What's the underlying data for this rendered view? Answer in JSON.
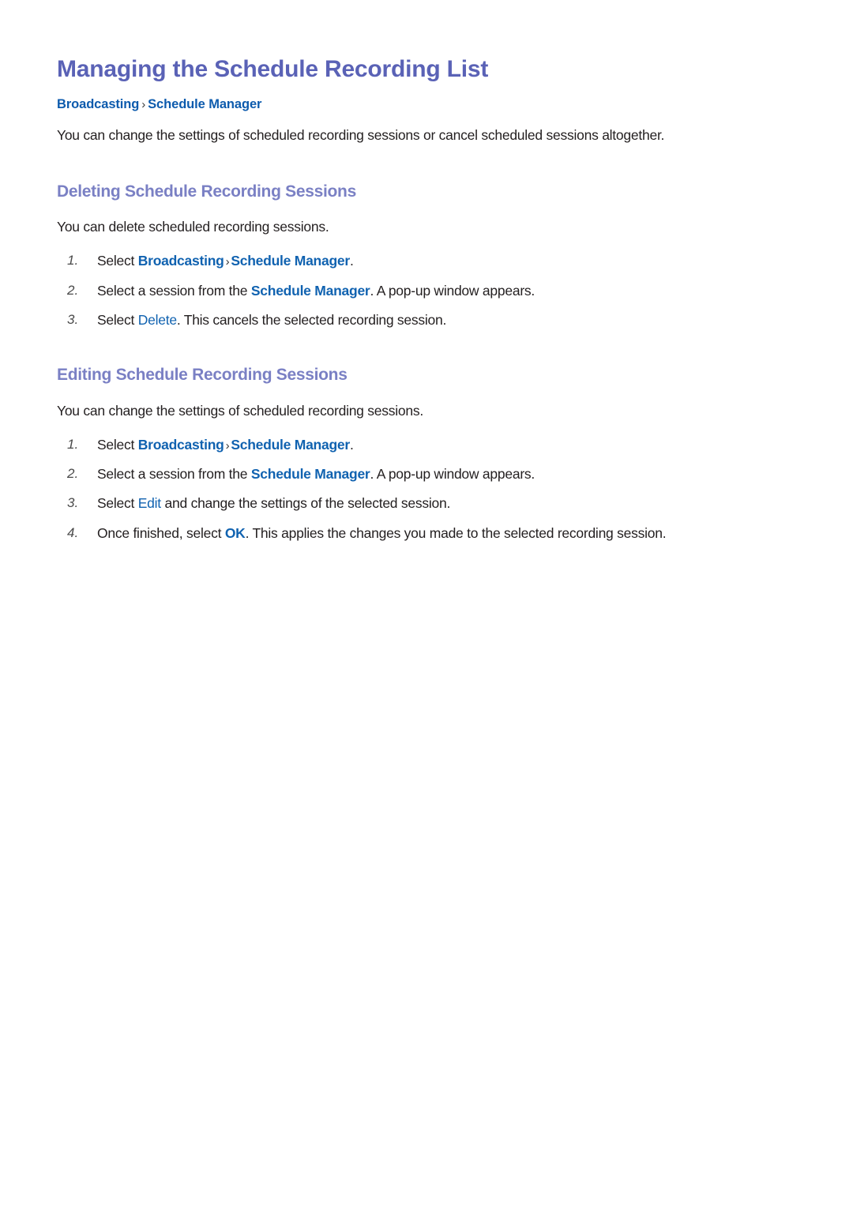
{
  "page": {
    "title": "Managing the Schedule Recording List",
    "breadcrumb": {
      "root": "Broadcasting",
      "separator": "›",
      "leaf": "Schedule Manager"
    },
    "intro": "You can change the settings of scheduled recording sessions or cancel scheduled sessions altogether."
  },
  "sections": [
    {
      "heading": "Deleting Schedule Recording Sessions",
      "lead": "You can delete scheduled recording sessions.",
      "steps": [
        {
          "number": "1.",
          "parts": [
            {
              "text": "Select ",
              "style": "plain"
            },
            {
              "text": "Broadcasting",
              "style": "term"
            },
            {
              "text": "›",
              "style": "arrow"
            },
            {
              "text": "Schedule Manager",
              "style": "term"
            },
            {
              "text": ".",
              "style": "plain"
            }
          ]
        },
        {
          "number": "2.",
          "parts": [
            {
              "text": "Select a session from the ",
              "style": "plain"
            },
            {
              "text": "Schedule Manager",
              "style": "term"
            },
            {
              "text": ". A pop-up window appears.",
              "style": "plain"
            }
          ]
        },
        {
          "number": "3.",
          "parts": [
            {
              "text": "Select ",
              "style": "plain"
            },
            {
              "text": "Delete",
              "style": "term-plain"
            },
            {
              "text": ". This cancels the selected recording session.",
              "style": "plain"
            }
          ]
        }
      ]
    },
    {
      "heading": "Editing Schedule Recording Sessions",
      "lead": "You can change the settings of scheduled recording sessions.",
      "steps": [
        {
          "number": "1.",
          "parts": [
            {
              "text": "Select ",
              "style": "plain"
            },
            {
              "text": "Broadcasting",
              "style": "term"
            },
            {
              "text": "›",
              "style": "arrow"
            },
            {
              "text": "Schedule Manager",
              "style": "term"
            },
            {
              "text": ".",
              "style": "plain"
            }
          ]
        },
        {
          "number": "2.",
          "parts": [
            {
              "text": "Select a session from the ",
              "style": "plain"
            },
            {
              "text": "Schedule Manager",
              "style": "term"
            },
            {
              "text": ". A pop-up window appears.",
              "style": "plain"
            }
          ]
        },
        {
          "number": "3.",
          "parts": [
            {
              "text": "Select ",
              "style": "plain"
            },
            {
              "text": "Edit",
              "style": "term-plain"
            },
            {
              "text": " and change the settings of the selected session.",
              "style": "plain"
            }
          ]
        },
        {
          "number": "4.",
          "parts": [
            {
              "text": "Once finished, select ",
              "style": "plain"
            },
            {
              "text": "OK",
              "style": "term"
            },
            {
              "text": ". This applies the changes you made to the selected recording session.",
              "style": "plain"
            }
          ]
        }
      ]
    }
  ],
  "colors": {
    "title": "#5a62b6",
    "section_heading": "#7a80c4",
    "breadcrumb": "#0d5bad",
    "inline_term": "#1062b0",
    "body_text": "#231f20",
    "background": "#ffffff"
  }
}
